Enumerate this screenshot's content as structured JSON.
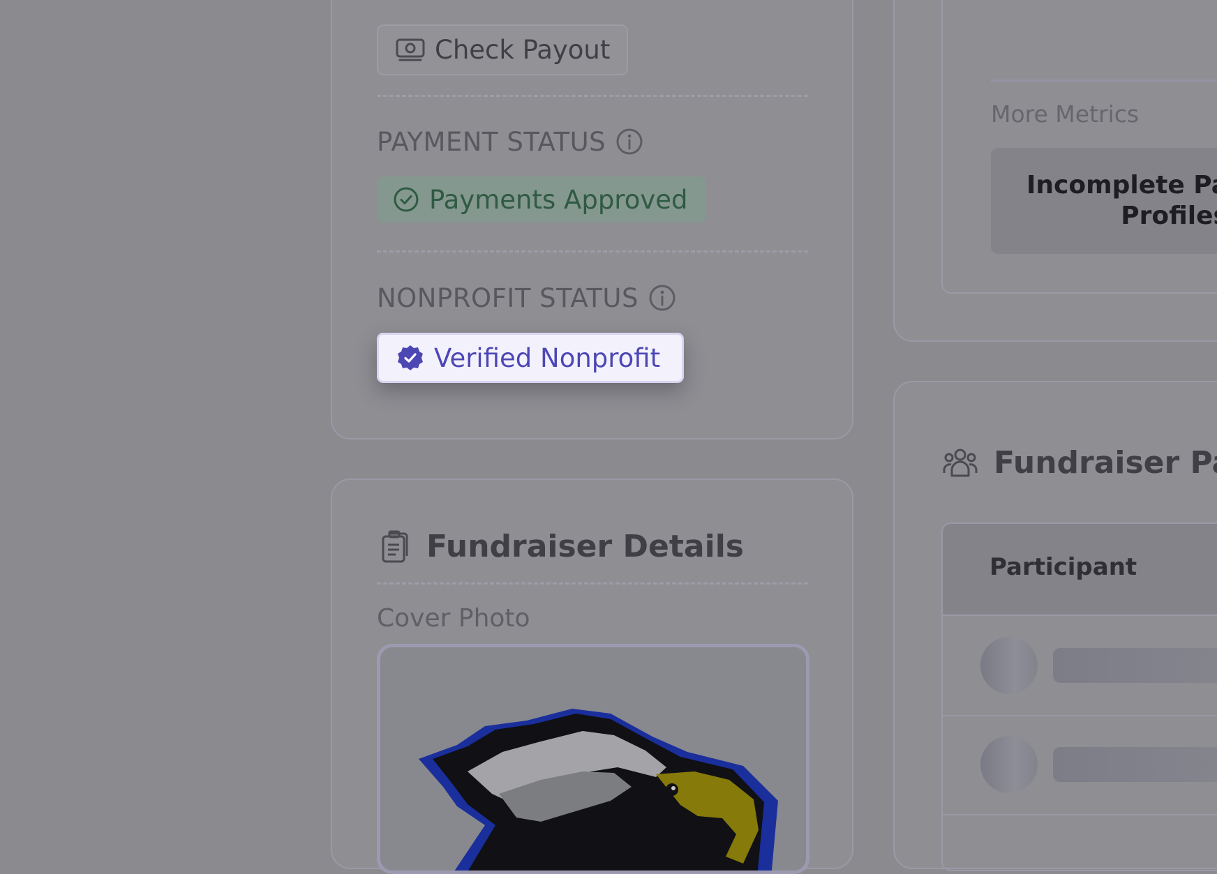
{
  "payout": {
    "button_label": "Check Payout"
  },
  "payment_status": {
    "label": "PAYMENT STATUS",
    "badge": "Payments Approved"
  },
  "nonprofit_status": {
    "label": "NONPROFIT STATUS",
    "badge": "Verified Nonprofit"
  },
  "details": {
    "title": "Fundraiser Details",
    "cover_photo_label": "Cover Photo"
  },
  "metrics": {
    "more_label": "More Metrics",
    "tile_text": "Incomplete Pa\nProfiles"
  },
  "participants": {
    "title": "Fundraiser Part",
    "column_header": "Participant"
  },
  "colors": {
    "approved_text": "#2f5a43",
    "verified_accent": "#4d47b4",
    "overlay": "#8b8b8f"
  },
  "icons": [
    "money-icon",
    "info-icon",
    "check-circle-icon",
    "verified-badge-icon",
    "clipboard-icon",
    "users-icon"
  ]
}
